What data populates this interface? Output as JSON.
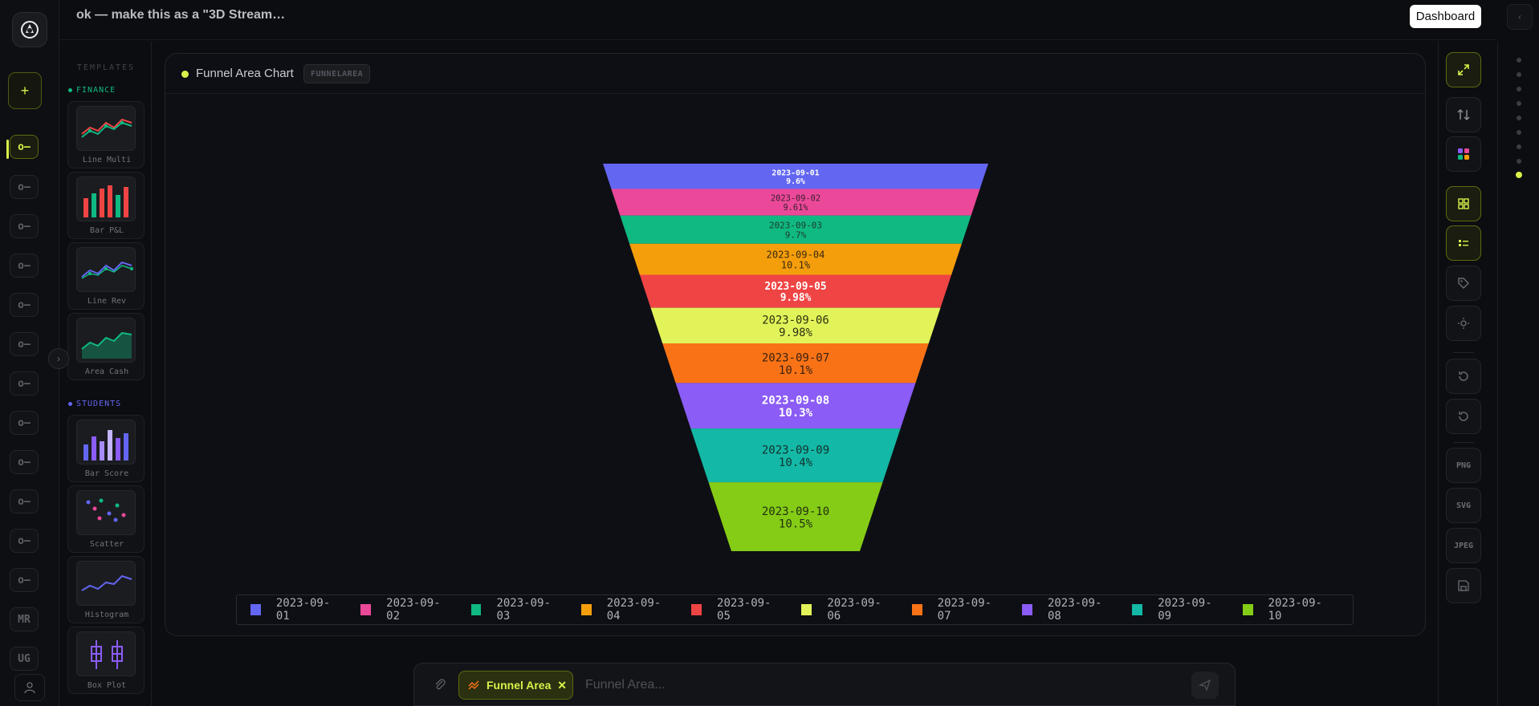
{
  "header": {
    "title": "ok — make this as a \"3D Stream…",
    "dashboard_label": "Dashboard"
  },
  "rail": {
    "items": [
      "o—",
      "o—",
      "o—",
      "o—",
      "o—",
      "o—",
      "o—",
      "o—",
      "o—",
      "o—",
      "o—",
      "o—",
      "MR",
      "UG"
    ]
  },
  "templates": {
    "heading": "TEMPLATES",
    "groups": [
      {
        "name": "FINANCE",
        "color": "#10b981",
        "items": [
          "Line Multi",
          "Bar P&L",
          "Line Rev",
          "Area Cash"
        ]
      },
      {
        "name": "STUDENTS",
        "color": "#6366f1",
        "items": [
          "Bar Score",
          "Scatter",
          "Histogram",
          "Box Plot"
        ]
      }
    ]
  },
  "card": {
    "title": "Funnel Area Chart",
    "badge": "FUNNELAREA"
  },
  "chart_data": {
    "type": "funnelarea",
    "categories": [
      "2023-09-01",
      "2023-09-02",
      "2023-09-03",
      "2023-09-04",
      "2023-09-05",
      "2023-09-06",
      "2023-09-07",
      "2023-09-08",
      "2023-09-09",
      "2023-09-10"
    ],
    "percent_labels": [
      "9.6%",
      "9.61%",
      "9.7%",
      "10.1%",
      "9.98%",
      "9.98%",
      "10.1%",
      "10.3%",
      "10.4%",
      "10.5%"
    ],
    "values": [
      9.6,
      9.61,
      9.7,
      10.1,
      9.98,
      9.98,
      10.1,
      10.3,
      10.4,
      10.5
    ],
    "colors": [
      "#6366f1",
      "#ec4899",
      "#10b981",
      "#f59e0b",
      "#ef4444",
      "#e2f35a",
      "#f97316",
      "#8b5cf6",
      "#14b8a6",
      "#84cc16"
    ],
    "text_colors": [
      "#ffffff",
      "#3a2030",
      "#1e3a2e",
      "#3a2a10",
      "#ffffff",
      "#2e3010",
      "#3a2010",
      "#ffffff",
      "#12322e",
      "#223010"
    ],
    "legend_placement": "bottom"
  },
  "toolbar": {
    "export_png": "PNG",
    "export_svg": "SVG",
    "export_jpeg": "JPEG"
  },
  "chat": {
    "chip_label": "Funnel Area",
    "placeholder": "Funnel Area..."
  }
}
